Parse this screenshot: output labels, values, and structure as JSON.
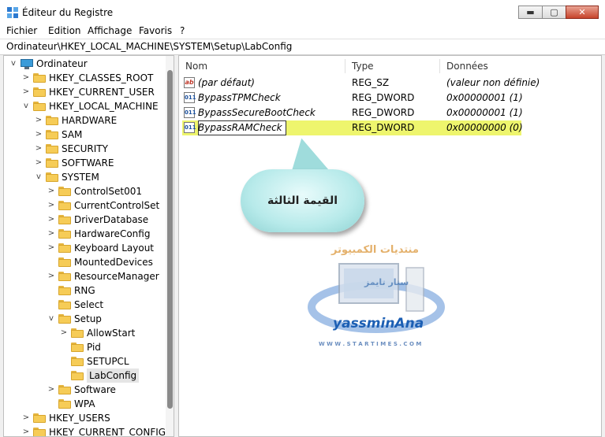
{
  "window": {
    "title": "Éditeur du Registre",
    "controls": {
      "minimize": "▬",
      "maximize": "▢",
      "close": "✕"
    }
  },
  "menu": [
    "Fichier",
    "Edition",
    "Affichage",
    "Favoris",
    "?"
  ],
  "address": "Ordinateur\\HKEY_LOCAL_MACHINE\\SYSTEM\\Setup\\LabConfig",
  "tree": {
    "root": "Ordinateur",
    "items": [
      {
        "label": "HKEY_CLASSES_ROOT",
        "expander": ">"
      },
      {
        "label": "HKEY_CURRENT_USER",
        "expander": ">"
      },
      {
        "label": "HKEY_LOCAL_MACHINE",
        "expander": "v"
      },
      {
        "label": "HARDWARE",
        "expander": ">"
      },
      {
        "label": "SAM",
        "expander": ">"
      },
      {
        "label": "SECURITY",
        "expander": ">"
      },
      {
        "label": "SOFTWARE",
        "expander": ">"
      },
      {
        "label": "SYSTEM",
        "expander": "v"
      },
      {
        "label": "ControlSet001",
        "expander": ">"
      },
      {
        "label": "CurrentControlSet",
        "expander": ">"
      },
      {
        "label": "DriverDatabase",
        "expander": ">"
      },
      {
        "label": "HardwareConfig",
        "expander": ">"
      },
      {
        "label": "Keyboard Layout",
        "expander": ">"
      },
      {
        "label": "MountedDevices",
        "expander": ""
      },
      {
        "label": "ResourceManager",
        "expander": ">"
      },
      {
        "label": "RNG",
        "expander": ""
      },
      {
        "label": "Select",
        "expander": ""
      },
      {
        "label": "Setup",
        "expander": "v"
      },
      {
        "label": "AllowStart",
        "expander": ">"
      },
      {
        "label": "Pid",
        "expander": ""
      },
      {
        "label": "SETUPCL",
        "expander": ""
      },
      {
        "label": "LabConfig",
        "expander": ""
      },
      {
        "label": "Software",
        "expander": ">"
      },
      {
        "label": "WPA",
        "expander": ""
      },
      {
        "label": "HKEY_USERS",
        "expander": ">"
      },
      {
        "label": "HKEY_CURRENT_CONFIG",
        "expander": ">"
      }
    ]
  },
  "list": {
    "headers": {
      "name": "Nom",
      "type": "Type",
      "data": "Données"
    },
    "rows": [
      {
        "icon": "ab",
        "name": "(par défaut)",
        "type": "REG_SZ",
        "data": "(valeur non définie)"
      },
      {
        "icon": "011",
        "name": "BypassTPMCheck",
        "type": "REG_DWORD",
        "data": "0x00000001 (1)"
      },
      {
        "icon": "011",
        "name": "BypassSecureBootCheck",
        "type": "REG_DWORD",
        "data": "0x00000001 (1)"
      },
      {
        "icon": "011",
        "name": "BypassRAMCheck",
        "type": "REG_DWORD",
        "data": "0x00000000 (0)"
      }
    ]
  },
  "callout": {
    "text": "القيمة الثالثة"
  },
  "watermark": {
    "forum": "منتديات الكمبيوتر",
    "brand": "ستار تايمز",
    "author": "yassminAna",
    "site": "W W W . S T A R T I M E S . C O M"
  }
}
